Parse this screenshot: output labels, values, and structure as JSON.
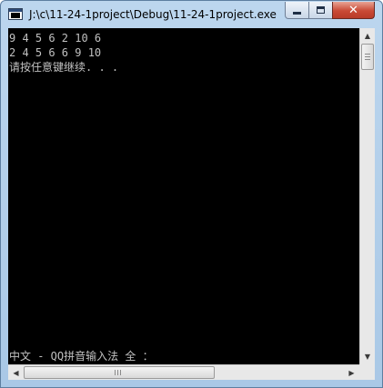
{
  "window": {
    "title": "J:\\c\\11-24-1project\\Debug\\11-24-1project.exe",
    "icon": "console-app-icon"
  },
  "controls": {
    "minimize": "minimize-icon",
    "maximize": "maximize-icon",
    "close_glyph": "✕"
  },
  "console": {
    "lines": [
      "9 4 5 6 2 10 6",
      "2 4 5 6 6 9 10",
      "请按任意键继续. . ."
    ],
    "ime_status": "中文 - QQ拼音输入法 全 ："
  },
  "scrollbars": {
    "up_glyph": "▲",
    "down_glyph": "▼",
    "left_glyph": "◀",
    "right_glyph": "▶"
  }
}
